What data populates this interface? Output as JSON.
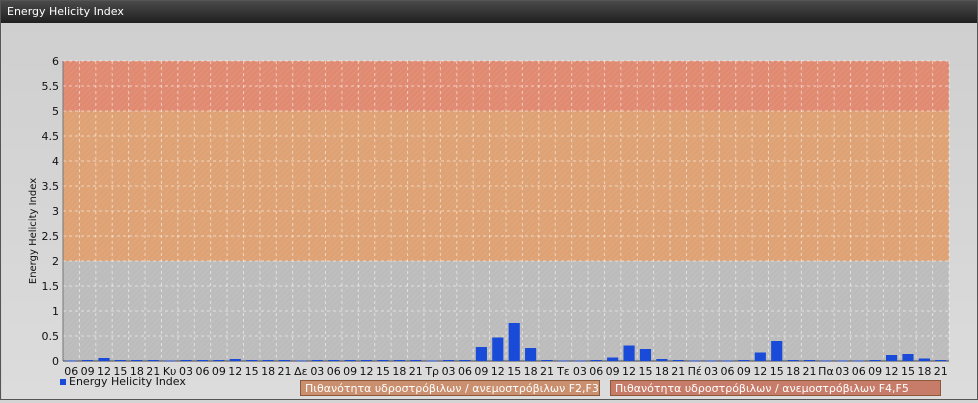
{
  "window": {
    "title": "Energy Helicity Index"
  },
  "colors": {
    "bar": "#1a4ad8",
    "band_low": "#bcbcbc",
    "band_mid": "#dea274",
    "band_high": "#e18a72",
    "zone_f23": "#c98f6e",
    "zone_f45": "#c77c6a"
  },
  "chart_data": {
    "type": "bar",
    "title": "",
    "xlabel": "",
    "ylabel": "Energy Helicity Index",
    "ylim": [
      0,
      6
    ],
    "yticks": [
      "0",
      "0.5",
      "1",
      "1.5",
      "2",
      "2.5",
      "3",
      "3.5",
      "4",
      "4.5",
      "5",
      "5.5",
      "6"
    ],
    "categories": [
      "06",
      "09",
      "12",
      "15",
      "18",
      "21",
      "Κυ",
      "03",
      "06",
      "09",
      "12",
      "15",
      "18",
      "21",
      "Δε",
      "03",
      "06",
      "09",
      "12",
      "15",
      "18",
      "21",
      "Τρ",
      "03",
      "06",
      "09",
      "12",
      "15",
      "18",
      "21",
      "Τε",
      "03",
      "06",
      "09",
      "12",
      "15",
      "18",
      "21",
      "Πέ",
      "03",
      "06",
      "09",
      "12",
      "15",
      "18",
      "21",
      "Πα",
      "03",
      "06",
      "09",
      "12",
      "15",
      "18",
      "21"
    ],
    "series": [
      {
        "name": "Energy Helicity Index",
        "values": [
          0.01,
          0.02,
          0.06,
          0.02,
          0.02,
          0.02,
          0.01,
          0.02,
          0.02,
          0.02,
          0.04,
          0.02,
          0.02,
          0.02,
          0.01,
          0.02,
          0.02,
          0.02,
          0.02,
          0.02,
          0.02,
          0.02,
          0.01,
          0.02,
          0.02,
          0.28,
          0.47,
          0.76,
          0.26,
          0.02,
          0.01,
          0.01,
          0.02,
          0.07,
          0.31,
          0.24,
          0.04,
          0.02,
          0.01,
          0.01,
          0.01,
          0.02,
          0.17,
          0.4,
          0.02,
          0.02,
          0.01,
          0.01,
          0.01,
          0.02,
          0.12,
          0.14,
          0.05,
          0.02
        ]
      }
    ],
    "bands": [
      {
        "from": 0,
        "to": 2,
        "color": "#bcbcbc"
      },
      {
        "from": 2,
        "to": 5,
        "color": "#dea274",
        "label": "Πιθανότητα υδροστρόβιλων / ανεμοστρόβιλων F2,F3"
      },
      {
        "from": 5,
        "to": 6,
        "color": "#e18a72",
        "label": "Πιθανότητα υδροστρόβιλων / ανεμοστρόβιλων F4,F5"
      }
    ],
    "grid": true,
    "legend": "bottom-left"
  }
}
